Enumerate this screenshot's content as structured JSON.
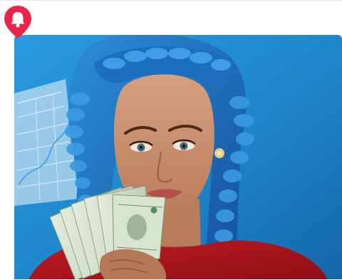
{
  "notification": {
    "icon": "bell-icon",
    "pin_color": "#e8244a",
    "icon_color": "#ffffff"
  },
  "hero": {
    "background_color": "#1f8fd1",
    "accent_hair_color": "#1e77c6",
    "top_color": "#b3151f",
    "banknote_color": "#cdd9c2"
  }
}
